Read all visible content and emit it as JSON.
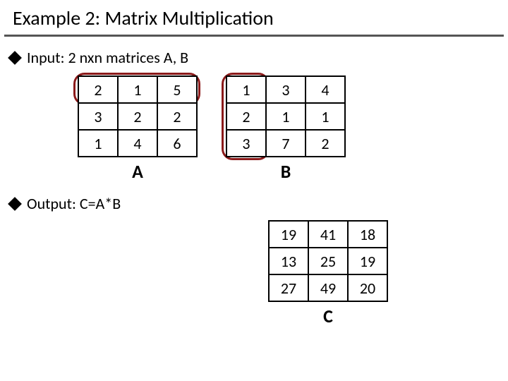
{
  "title": "Example 2: Matrix Multiplication",
  "input_label": "Input: 2 nxn matrices A, B",
  "output_label": "Output: C=A*B",
  "matrixA": {
    "label": "A",
    "rows": [
      [
        "2",
        "1",
        "5"
      ],
      [
        "3",
        "2",
        "2"
      ],
      [
        "1",
        "4",
        "6"
      ]
    ]
  },
  "matrixB": {
    "label": "B",
    "rows": [
      [
        "1",
        "3",
        "4"
      ],
      [
        "2",
        "1",
        "1"
      ],
      [
        "3",
        "7",
        "2"
      ]
    ]
  },
  "matrixC": {
    "label": "C",
    "rows": [
      [
        "19",
        "41",
        "18"
      ],
      [
        "13",
        "25",
        "19"
      ],
      [
        "27",
        "49",
        "20"
      ]
    ]
  }
}
